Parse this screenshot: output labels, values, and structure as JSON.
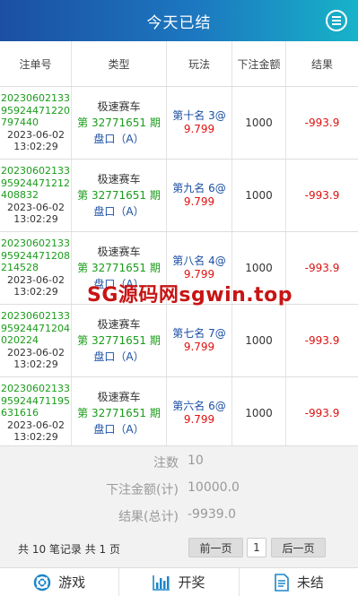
{
  "header": {
    "title": "今天已结"
  },
  "table": {
    "columns": [
      "注单号",
      "类型",
      "玩法",
      "下注金额",
      "结果"
    ],
    "rows": [
      {
        "order_no": "2023060213395924471220797440",
        "time": "2023-06-02 13:02:29",
        "game": "极速赛车",
        "period": "第 32771651 期",
        "market": "盘口（A）",
        "play": "第十名 3@",
        "odds": "9.799",
        "amount": "1000",
        "result": "-993.9"
      },
      {
        "order_no": "2023060213395924471212408832",
        "time": "2023-06-02 13:02:29",
        "game": "极速赛车",
        "period": "第 32771651 期",
        "market": "盘口（A）",
        "play": "第九名 6@",
        "odds": "9.799",
        "amount": "1000",
        "result": "-993.9"
      },
      {
        "order_no": "2023060213395924471208214528",
        "time": "2023-06-02 13:02:29",
        "game": "极速赛车",
        "period": "第 32771651 期",
        "market": "盘口（A）",
        "play": "第八名 4@",
        "odds": "9.799",
        "amount": "1000",
        "result": "-993.9"
      },
      {
        "order_no": "2023060213395924471204020224",
        "time": "2023-06-02 13:02:29",
        "game": "极速赛车",
        "period": "第 32771651 期",
        "market": "盘口（A）",
        "play": "第七名 7@",
        "odds": "9.799",
        "amount": "1000",
        "result": "-993.9"
      },
      {
        "order_no": "2023060213395924471195631616",
        "time": "2023-06-02 13:02:29",
        "game": "极速赛车",
        "period": "第 32771651 期",
        "market": "盘口（A）",
        "play": "第六名 6@",
        "odds": "9.799",
        "amount": "1000",
        "result": "-993.9"
      }
    ]
  },
  "watermark": "SG源码网sgwin.top",
  "summary": {
    "count_label": "注数",
    "count_value": "10",
    "amount_label": "下注金额(计)",
    "amount_value": "10000.0",
    "result_label": "结果(总计)",
    "result_value": "-9939.0"
  },
  "pager": {
    "info": "共 10 笔记录  共 1 页",
    "prev": "前一页",
    "current": "1",
    "next": "后一页"
  },
  "tabs": [
    {
      "label": "游戏",
      "icon": "lifebuoy-icon"
    },
    {
      "label": "开奖",
      "icon": "bar-chart-icon"
    },
    {
      "label": "未结",
      "icon": "document-icon"
    }
  ],
  "colors": {
    "header_start": "#1b4fa3",
    "header_end": "#17b3c8",
    "green": "#1a9c1a",
    "blue": "#1b4fa3",
    "red": "#e01010"
  }
}
